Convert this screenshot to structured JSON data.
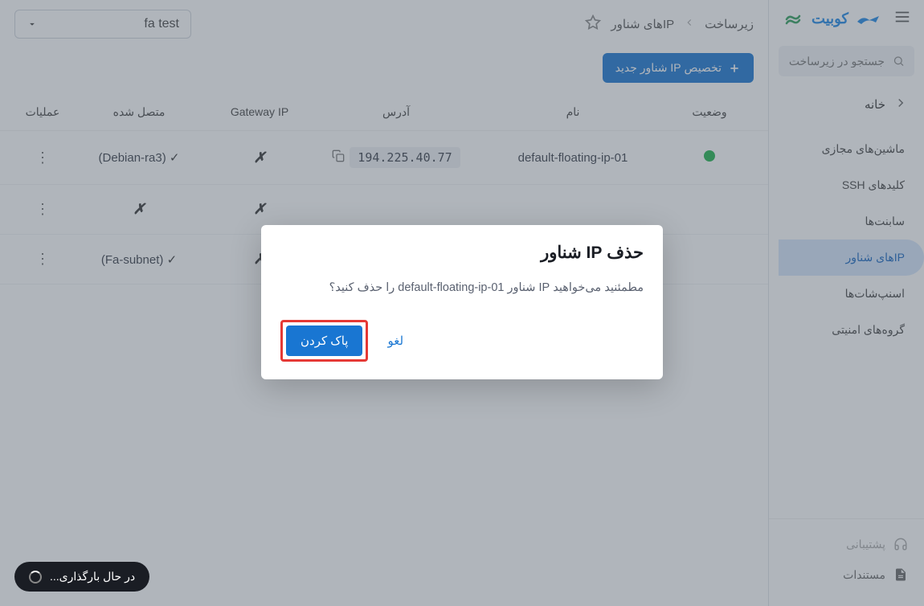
{
  "brand": {
    "name": "کوبیت"
  },
  "search": {
    "placeholder": "جستجو در زیرساخت"
  },
  "nav": {
    "home": "خانه",
    "items": [
      {
        "label": "ماشین‌های مجازی"
      },
      {
        "label": "کلیدهای SSH"
      },
      {
        "label": "سابنت‌ها"
      },
      {
        "label": "IPهای شناور"
      },
      {
        "label": "اسنپ‌شات‌ها"
      },
      {
        "label": "گروه‌های امنیتی"
      }
    ],
    "active_index": 3
  },
  "footer": {
    "support": "پشتیبانی",
    "docs": "مستندات"
  },
  "breadcrumb": {
    "root": "زیرساخت",
    "current": "IPهای شناور"
  },
  "project_selector": {
    "value": "fa test"
  },
  "actions": {
    "new_fip": "تخصیص IP شناور جدید"
  },
  "table": {
    "headers": {
      "status": "وضعیت",
      "name": "نام",
      "address": "آدرس",
      "gateway": "Gateway IP",
      "connected": "متصل شده",
      "ops": "عملیات"
    },
    "rows": [
      {
        "status": "up",
        "name": "default-floating-ip-01",
        "address": "194.225.40.77",
        "gateway": "x",
        "connected": "(Debian-ra3)",
        "connected_ok": true
      },
      {
        "status": "",
        "name": "",
        "address": "",
        "gateway": "x",
        "connected": "x",
        "connected_ok": false
      },
      {
        "status": "",
        "name": "",
        "address": "",
        "gateway": "x",
        "connected": "(Fa-subnet)",
        "connected_ok": true
      }
    ]
  },
  "dialog": {
    "title": "حذف IP شناور",
    "body": "مطمئنید می‌خواهید IP شناور default-floating-ip-01 را حذف کنید؟",
    "cancel": "لغو",
    "confirm": "پاک کردن"
  },
  "loading": {
    "text": "در حال بارگذاری..."
  }
}
